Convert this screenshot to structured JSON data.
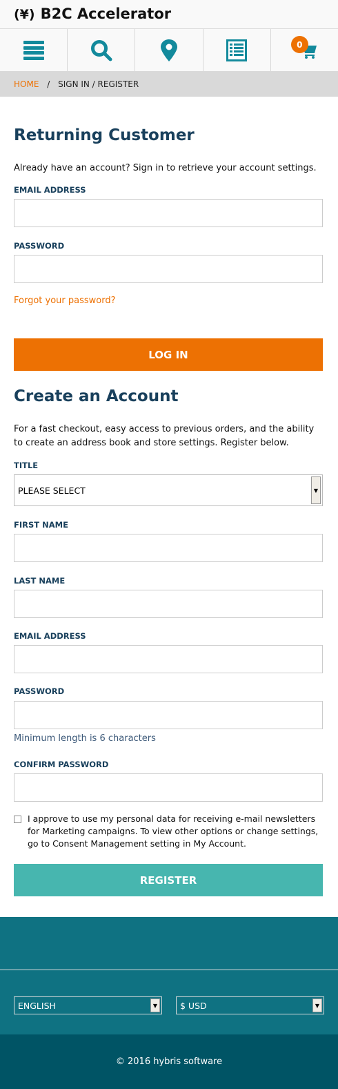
{
  "header": {
    "logo_mark": "(¥)",
    "title": "B2C Accelerator"
  },
  "nav": {
    "cart_count": "0",
    "accent": "#138a9c"
  },
  "breadcrumb": {
    "home": "HOME",
    "separator": "/",
    "current": "SIGN IN / REGISTER"
  },
  "login": {
    "heading": "Returning Customer",
    "intro": "Already have an account? Sign in to retrieve your account settings.",
    "email_label": "EMAIL ADDRESS",
    "password_label": "PASSWORD",
    "forgot": "Forgot your password?",
    "button": "LOG IN"
  },
  "register": {
    "heading": "Create an Account",
    "intro": "For a fast checkout, easy access to previous orders, and the ability to create an address book and store settings. Register below.",
    "title_label": "TITLE",
    "title_value": "PLEASE SELECT",
    "first_name_label": "FIRST NAME",
    "last_name_label": "LAST NAME",
    "email_label": "EMAIL ADDRESS",
    "password_label": "PASSWORD",
    "password_hint": "Minimum length is 6 characters",
    "confirm_label": "CONFIRM PASSWORD",
    "consent": "I approve to use my personal data for receiving e-mail newsletters for Marketing campaigns.   To view other options or change settings, go to Consent Management setting in My Account.",
    "button": "REGISTER"
  },
  "footer": {
    "language": "ENGLISH",
    "currency": "$ USD",
    "copyright": "© 2016 hybris software"
  }
}
